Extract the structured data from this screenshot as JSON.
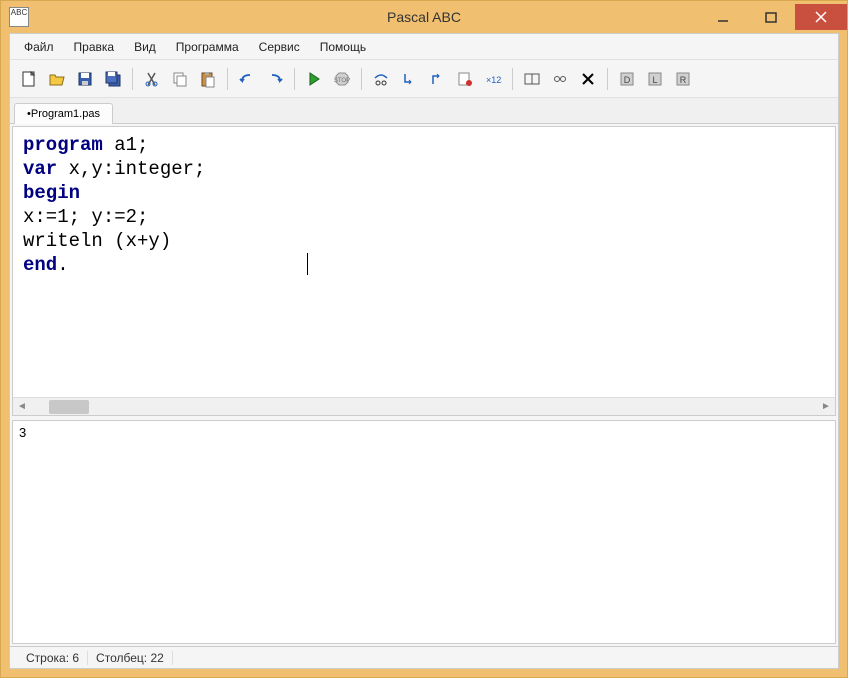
{
  "window": {
    "title": "Pascal ABC",
    "app_icon_text": "ABC"
  },
  "menu": {
    "items": [
      "Файл",
      "Правка",
      "Вид",
      "Программа",
      "Сервис",
      "Помощь"
    ]
  },
  "toolbar": {
    "icons": [
      "new-file-icon",
      "open-file-icon",
      "save-icon",
      "save-all-icon",
      "cut-icon",
      "copy-icon",
      "paste-icon",
      "undo-icon",
      "redo-icon",
      "run-icon",
      "stop-icon",
      "step-over-icon",
      "step-into-icon",
      "step-out-icon",
      "breakpoint-icon",
      "evaluate-icon",
      "window-split-icon",
      "window-list-icon",
      "close-window-icon",
      "tool1-icon",
      "tool2-icon",
      "tool3-icon"
    ]
  },
  "tab": {
    "label": "•Program1.pas"
  },
  "code": {
    "line1_kw": "program",
    "line1_rest": " a1;",
    "line2_kw": "var",
    "line2_rest": " x,y:integer;",
    "line3_kw": "begin",
    "line4": "x:=1; y:=2;",
    "line5": "writeln (x+y)",
    "line6_kw": "end",
    "line6_rest": "."
  },
  "output": {
    "text": "3"
  },
  "status": {
    "row_label": "Строка: 6",
    "col_label": "Столбец: 22"
  }
}
